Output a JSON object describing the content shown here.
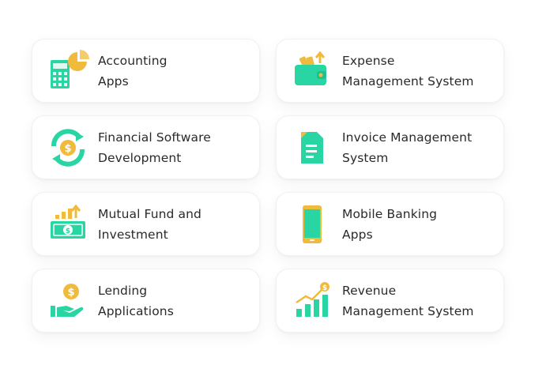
{
  "colors": {
    "accent_teal": "#2ad5a4",
    "accent_teal_dark": "#1fbf8f",
    "accent_gold": "#f0bb3c",
    "text": "#2a2a2a",
    "card_border": "#f1f1f1"
  },
  "cards": [
    {
      "icon": "calculator-pie-chart-icon",
      "line1": "Accounting",
      "line2": "Apps"
    },
    {
      "icon": "wallet-icon",
      "line1": "Expense",
      "line2": "Management System"
    },
    {
      "icon": "dollar-cycle-icon",
      "line1": "Financial Software",
      "line2": "Development"
    },
    {
      "icon": "invoice-document-icon",
      "line1": "Invoice Management",
      "line2": "System"
    },
    {
      "icon": "cash-growth-icon",
      "line1": "Mutual Fund and",
      "line2": "Investment"
    },
    {
      "icon": "mobile-phone-icon",
      "line1": "Mobile Banking",
      "line2": "Apps"
    },
    {
      "icon": "hand-coin-icon",
      "line1": "Lending",
      "line2": "Applications"
    },
    {
      "icon": "revenue-chart-icon",
      "line1": "Revenue",
      "line2": "Management System"
    }
  ]
}
